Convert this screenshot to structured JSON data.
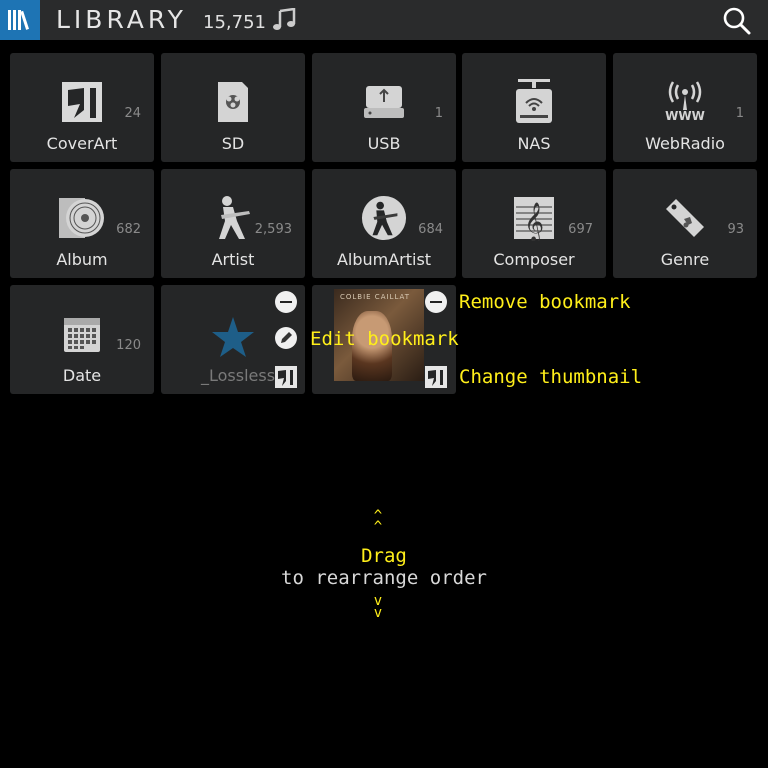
{
  "header": {
    "title": "LIBRARY",
    "track_count": "15,751",
    "icons": [
      "library-icon",
      "music-note-icon",
      "search-icon"
    ]
  },
  "tiles": [
    {
      "label": "CoverArt",
      "count": "24",
      "icon": "coverart-icon"
    },
    {
      "label": "SD",
      "count": "",
      "icon": "sd-card-icon"
    },
    {
      "label": "USB",
      "count": "1",
      "icon": "usb-drive-icon"
    },
    {
      "label": "NAS",
      "count": "",
      "icon": "nas-icon"
    },
    {
      "label": "WebRadio",
      "count": "1",
      "icon": "webradio-icon"
    },
    {
      "label": "Album",
      "count": "682",
      "icon": "album-icon"
    },
    {
      "label": "Artist",
      "count": "2,593",
      "icon": "artist-icon"
    },
    {
      "label": "AlbumArtist",
      "count": "684",
      "icon": "album-artist-icon"
    },
    {
      "label": "Composer",
      "count": "697",
      "icon": "composer-icon"
    },
    {
      "label": "Genre",
      "count": "93",
      "icon": "genre-tag-icon"
    },
    {
      "label": "Date",
      "count": "120",
      "icon": "calendar-icon"
    },
    {
      "label": "_Lossless",
      "count": "",
      "icon": "star-icon"
    }
  ],
  "album_cover_text": "COLBIE CAILLAT",
  "hints": {
    "remove": "Remove bookmark",
    "edit": "Edit bookmark",
    "change": "Change thumbnail",
    "drag": "Drag",
    "drag_sub": "to rearrange order",
    "arrow_up": "^",
    "arrow_down": "v"
  },
  "colors": {
    "accent": "#1e74b4",
    "hint": "#ffef1a",
    "tile": "#252627",
    "header": "#2a2b2c"
  }
}
